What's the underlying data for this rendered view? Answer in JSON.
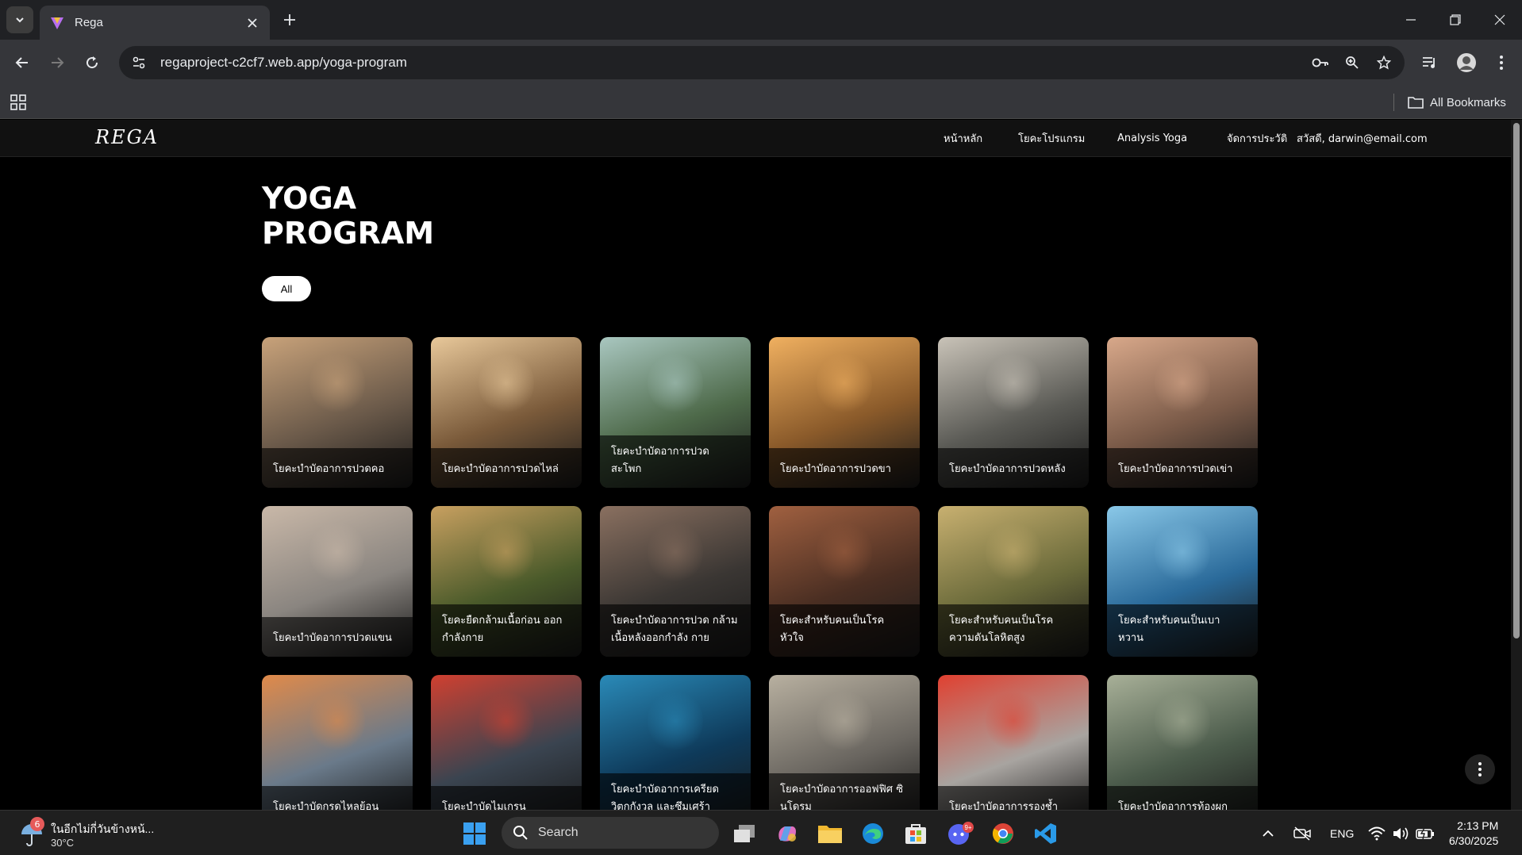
{
  "browser": {
    "tab_title": "Rega",
    "url": "regaproject-c2cf7.web.app/yoga-program",
    "all_bookmarks": "All Bookmarks"
  },
  "site": {
    "logo": "REGA",
    "nav": {
      "home": "หน้าหลัก",
      "program": "โยคะโปรแกรม",
      "analysis": "Analysis Yoga",
      "history": "จัดการประวัติ",
      "user": "สวัสดี, darwin@email.com"
    }
  },
  "main": {
    "title_line1": "YOGA",
    "title_line2": "PROGRAM",
    "filter_all": "All",
    "cards": [
      {
        "label": "โยคะบำบัดอาการปวดคอ",
        "bg": "#6b5a4a",
        "accent": "#c8a27a"
      },
      {
        "label": "โยคะบำบัดอาการปวดไหล่",
        "bg": "#7a5a3a",
        "accent": "#e8c89a"
      },
      {
        "label": "โยคะบำบัดอาการปวด สะโพก",
        "bg": "#4e6a4a",
        "accent": "#a9c7c0"
      },
      {
        "label": "โยคะบำบัดอาการปวดขา",
        "bg": "#8a5a2a",
        "accent": "#f0b060"
      },
      {
        "label": "โยคะบำบัดอาการปวดหลัง",
        "bg": "#5a5a55",
        "accent": "#c9c3b8"
      },
      {
        "label": "โยคะบำบัดอาการปวดเข่า",
        "bg": "#7a5a48",
        "accent": "#d8a88a"
      },
      {
        "label": "โยคะบำบัดอาการปวดแขน",
        "bg": "#8a8580",
        "accent": "#c9b8a8"
      },
      {
        "label": "โยคะยืดกล้ามเนื้อก่อน ออกกำลังกาย",
        "bg": "#4a5a2a",
        "accent": "#c8a060"
      },
      {
        "label": "โยคะบำบัดอาการปวด กล้ามเนื้อหลังออกกำลัง กาย",
        "bg": "#3a3633",
        "accent": "#8a7060"
      },
      {
        "label": "โยคะสำหรับคนเป็นโรค หัวใจ",
        "bg": "#4a2e22",
        "accent": "#a06040"
      },
      {
        "label": "โยคะสำหรับคนเป็นโรค ความดันโลหิตสูง",
        "bg": "#6a6a3a",
        "accent": "#c8b070"
      },
      {
        "label": "โยคะสำหรับคนเป็นเบา หวาน",
        "bg": "#2a6a9a",
        "accent": "#8ac8e8"
      },
      {
        "label": "โยคะบำบัดกรดไหลย้อน",
        "bg": "#6a7a8a",
        "accent": "#e08a4a"
      },
      {
        "label": "โยคะบำบัดไมเกรน",
        "bg": "#3a4450",
        "accent": "#d04030"
      },
      {
        "label": "โยคะบำบัดอาการเครียด วิตกกังวล และซึมเศร้า",
        "bg": "#0e3a5a",
        "accent": "#2a8ab8"
      },
      {
        "label": "โยคะบำบัดอาการออฟฟิศ ซินโดรม",
        "bg": "#6a6660",
        "accent": "#b8b0a0"
      },
      {
        "label": "โยคะบำบัดอาการรองช้ำ",
        "bg": "#a8a4a0",
        "accent": "#e04030"
      },
      {
        "label": "โยคะบำบัดอาการท้องผูก",
        "bg": "#4a5a4a",
        "accent": "#a8b098"
      }
    ]
  },
  "taskbar": {
    "weather_text": "ในอีกไม่กี่วันข้างหน้...",
    "weather_temp": "30°C",
    "weather_badge": "6",
    "search": "Search",
    "lang": "ENG",
    "time": "2:13 PM",
    "date": "6/30/2025",
    "discord_badge": "9+"
  }
}
